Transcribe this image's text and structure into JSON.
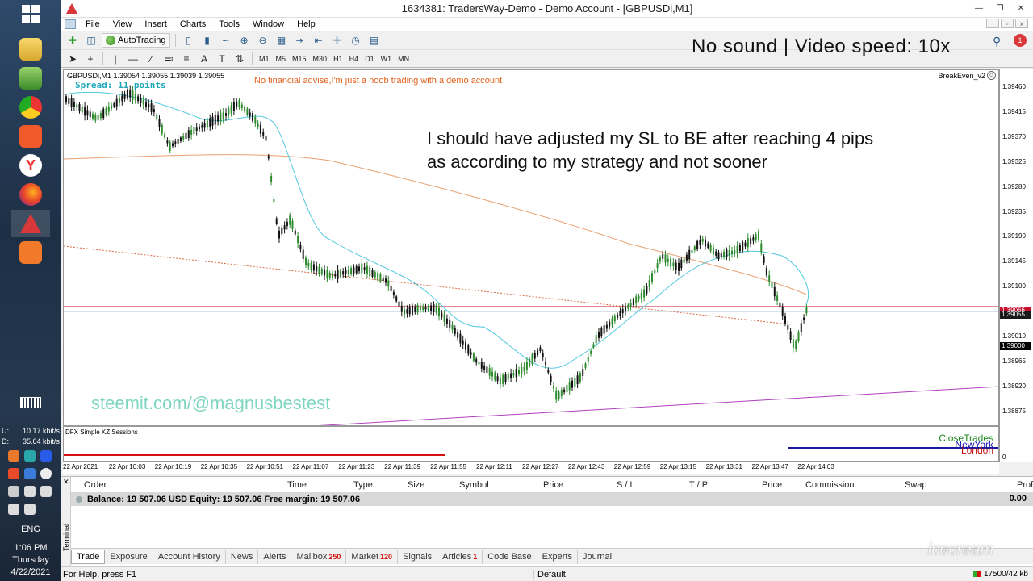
{
  "window": {
    "title": "1634381: TradersWay-Demo - Demo Account - [GBPUSDi,M1]"
  },
  "menu": [
    "File",
    "View",
    "Insert",
    "Charts",
    "Tools",
    "Window",
    "Help"
  ],
  "toolbar": {
    "autotrading_label": "AutoTrading",
    "timeframes": [
      "M1",
      "M5",
      "M15",
      "M30",
      "H1",
      "H4",
      "D1",
      "W1",
      "MN"
    ]
  },
  "overlay_banner": "No sound | Video speed: 10x",
  "notification_count": "1",
  "chart": {
    "header": "GBPUSDi,M1  1.39054 1.39055 1.39039 1.39055",
    "spread": "Spread: 11 points",
    "disclaimer": "No financial advise,I'm just a noob trading with a demo account",
    "ea_name": "BreakEven_v2",
    "note_line1": "I should have adjusted my SL to BE after reaching 4 pips",
    "note_line2": "as according to my strategy and not sooner",
    "watermark": "steemit.com/@magnusbestest",
    "price_labels": [
      "1.39460",
      "1.39415",
      "1.39370",
      "1.39325",
      "1.39280",
      "1.39235",
      "1.39190",
      "1.39145",
      "1.39100",
      "1.39055",
      "1.39010",
      "1.38965",
      "1.38920",
      "1.38875"
    ],
    "price_tags": {
      "red": "1.39066",
      "blue": "1.39055",
      "black": "1.39000"
    },
    "time_labels": [
      "22 Apr 2021",
      "22 Apr 10:03",
      "22 Apr 10:19",
      "22 Apr 10:35",
      "22 Apr 10:51",
      "22 Apr 11:07",
      "22 Apr 11:23",
      "22 Apr 11:39",
      "22 Apr 11:55",
      "22 Apr 12:11",
      "22 Apr 12:27",
      "22 Apr 12:43",
      "22 Apr 12:59",
      "22 Apr 13:15",
      "22 Apr 13:31",
      "22 Apr 13:47",
      "22 Apr 14:03"
    ]
  },
  "indicator": {
    "name": "DFX Simple KZ Sessions",
    "close_trades": "CloseTrades",
    "new_york": "NewYork",
    "london": "London",
    "zero": "0"
  },
  "terminal": {
    "side_label": "Terminal",
    "columns": [
      "Order",
      "Time",
      "Type",
      "Size",
      "Symbol",
      "Price",
      "S / L",
      "T / P",
      "Price",
      "Commission",
      "Swap",
      "Profit"
    ],
    "balance_text": "Balance: 19 507.06 USD  Equity: 19 507.06  Free margin: 19 507.06",
    "balance_total": "0.00",
    "tabs": [
      {
        "label": "Trade",
        "count": ""
      },
      {
        "label": "Exposure",
        "count": ""
      },
      {
        "label": "Account History",
        "count": ""
      },
      {
        "label": "News",
        "count": ""
      },
      {
        "label": "Alerts",
        "count": ""
      },
      {
        "label": "Mailbox",
        "count": "250"
      },
      {
        "label": "Market",
        "count": "120"
      },
      {
        "label": "Signals",
        "count": ""
      },
      {
        "label": "Articles",
        "count": "1"
      },
      {
        "label": "Code Base",
        "count": ""
      },
      {
        "label": "Experts",
        "count": ""
      },
      {
        "label": "Journal",
        "count": ""
      }
    ]
  },
  "status": {
    "help": "For Help, press F1",
    "profile": "Default",
    "connection": "17500/42 kb"
  },
  "taskbar": {
    "net_up_label": "U:",
    "net_up": "10.17 kbit/s",
    "net_down_label": "D:",
    "net_down": "35.64 kbit/s",
    "language": "ENG",
    "time": "1:06 PM",
    "day": "Thursday",
    "date": "4/22/2021"
  },
  "brand_watermark": "icecream"
}
